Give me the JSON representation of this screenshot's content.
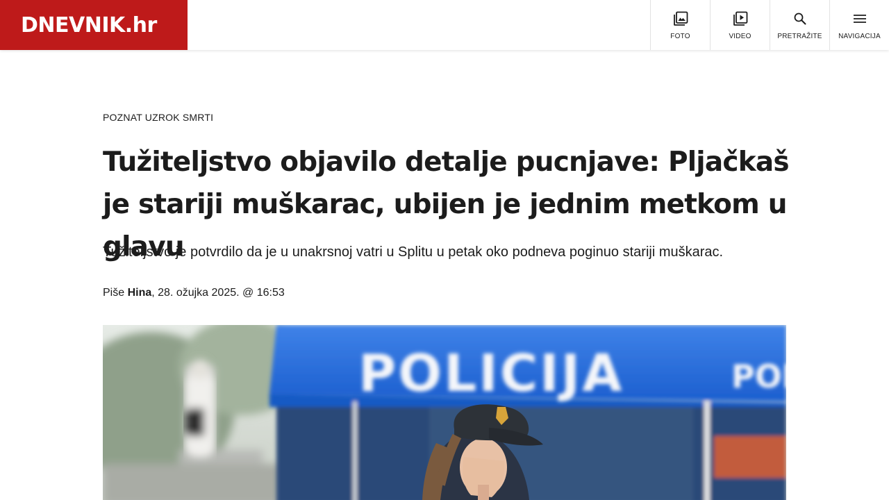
{
  "brand": {
    "logo_text": "DNEVNIK.hr",
    "color": "#be1a1a"
  },
  "nav": {
    "items": [
      {
        "label": "FOTO",
        "icon": "photo-gallery-icon"
      },
      {
        "label": "VIDEO",
        "icon": "video-play-icon"
      },
      {
        "label": "PRETRAŽITE",
        "icon": "search-icon"
      },
      {
        "label": "NAVIGACIJA",
        "icon": "hamburger-menu-icon"
      }
    ]
  },
  "article": {
    "kicker": "POZNAT UZROK SMRTI",
    "title": "Tužiteljstvo objavilo detalje pucnjave: Pljačkaš je stariji muškarac, ubijen je jednim metkom u glavu",
    "lead": "Tužiteljstvo je potvrdilo da je u unakrsnoj vatri u Splitu u petak oko podneva poginuo stariji muškarac.",
    "byline": {
      "prefix": "Piše ",
      "author": "Hina",
      "date": ", 28. ožujka 2025. @ 16:53"
    },
    "hero_image": {
      "tent_text": "POLICIJA",
      "tent_side_text": "POLICI"
    }
  }
}
